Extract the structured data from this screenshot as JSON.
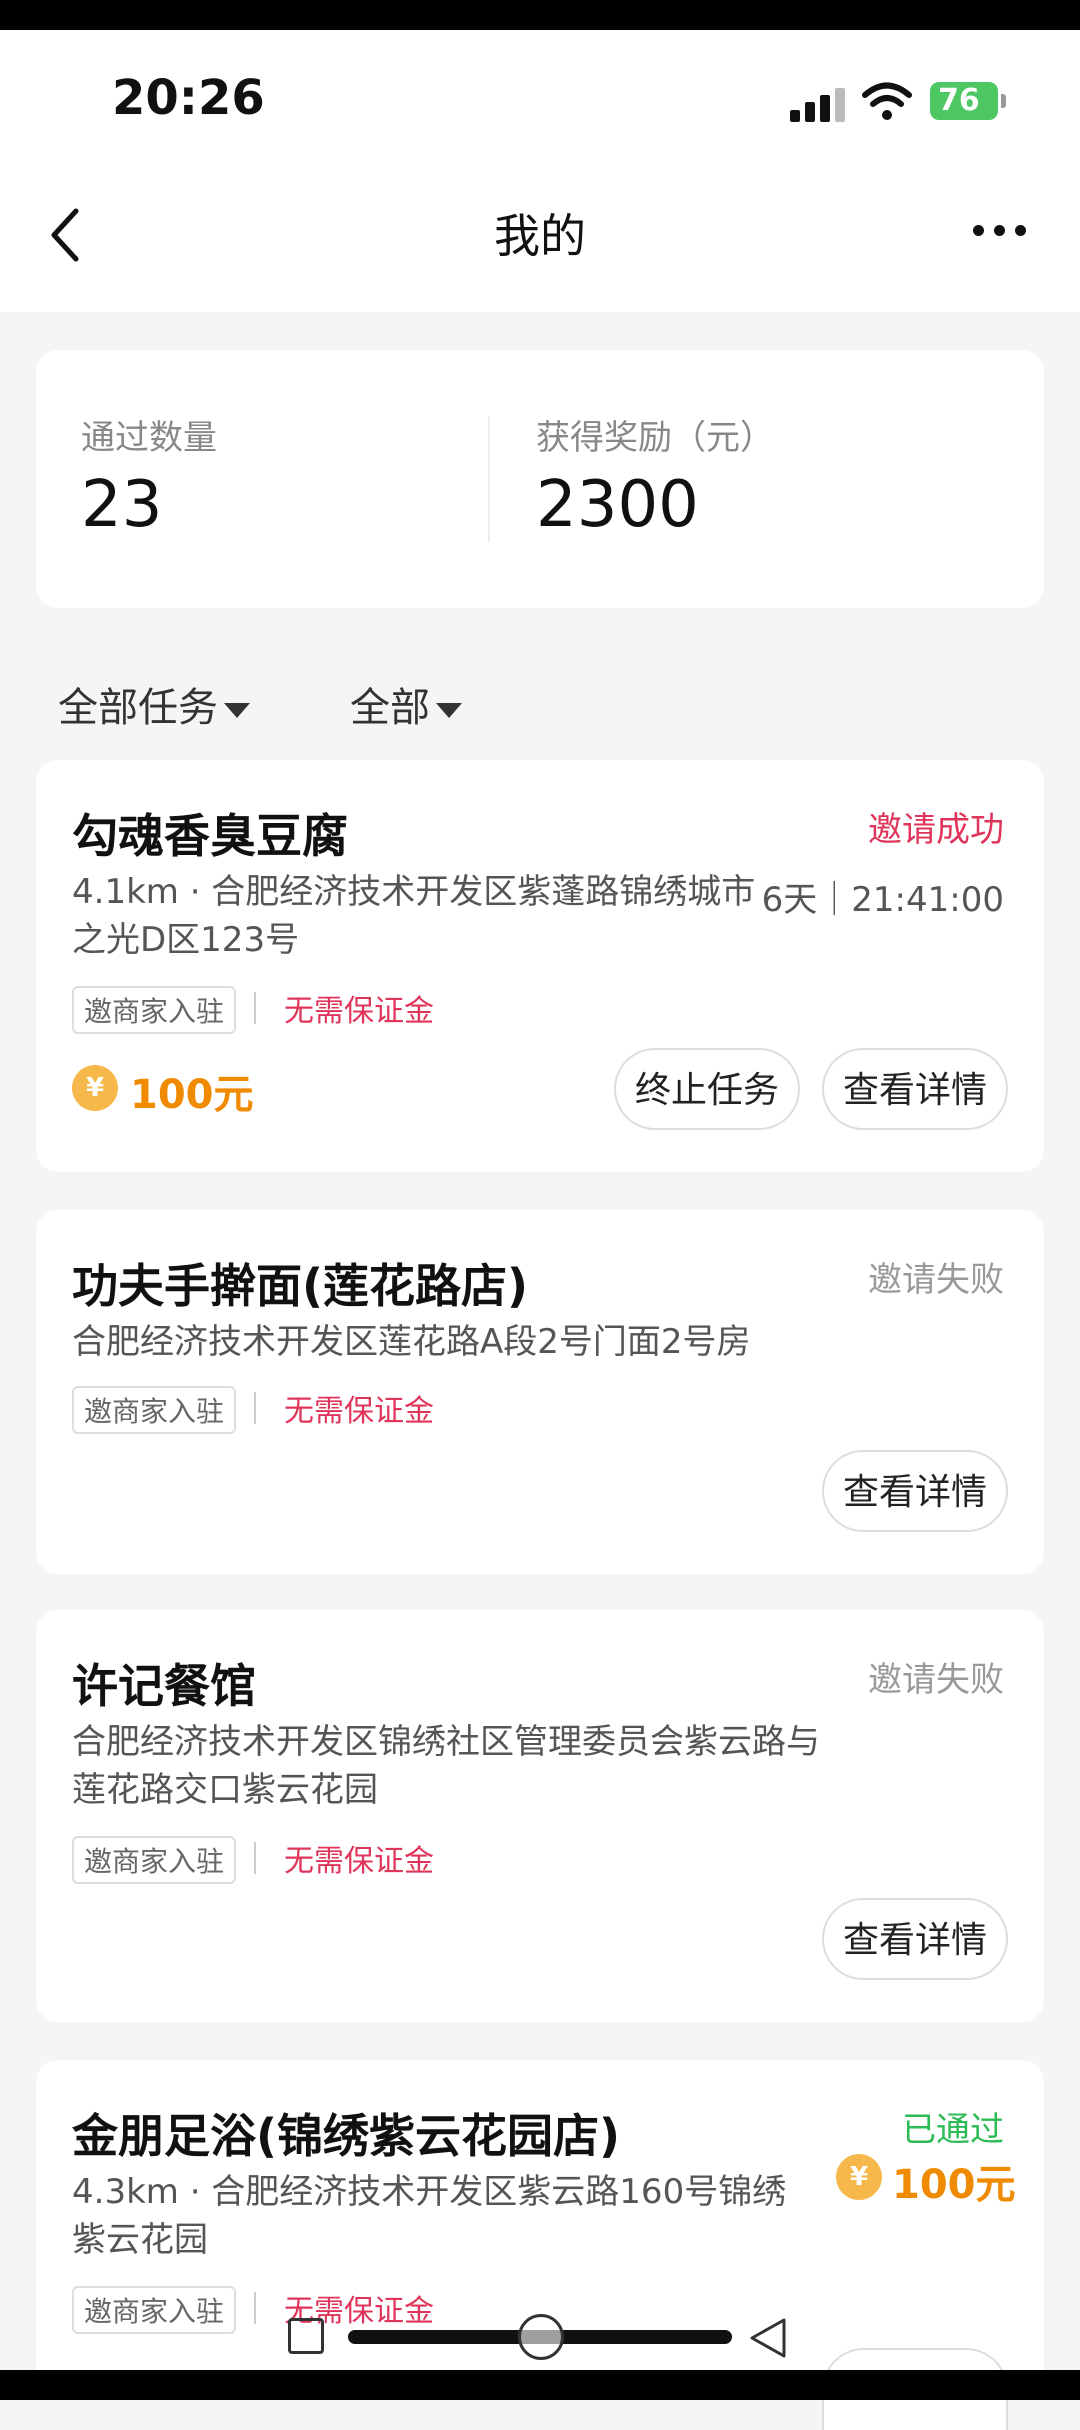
{
  "status_bar": {
    "time": "20:26",
    "battery": "76"
  },
  "header": {
    "title": "我的"
  },
  "stats": {
    "passed_label": "通过数量",
    "passed_value": "23",
    "reward_label": "获得奖励（元）",
    "reward_value": "2300"
  },
  "filters": {
    "task_filter": "全部任务",
    "status_filter": "全部"
  },
  "cards": [
    {
      "name": "勾魂香臭豆腐",
      "status": "邀请成功",
      "addr_line1": "4.1km · 合肥经济技术开发区紫蓬路锦绣城市",
      "addr_line2": "之光D区123号",
      "countdown": "6天｜21:41:00",
      "tag1": "邀商家入驻",
      "tag2": "无需保证金",
      "coin": "¥",
      "reward": "100元",
      "btn_stop": "终止任务",
      "btn_detail": "查看详情"
    },
    {
      "name": "功夫手擀面(莲花路店)",
      "status": "邀请失败",
      "addr_line1": "合肥经济技术开发区莲花路A段2号门面2号房",
      "tag1": "邀商家入驻",
      "tag2": "无需保证金",
      "btn_detail": "查看详情"
    },
    {
      "name": "许记餐馆",
      "status": "邀请失败",
      "addr_line1": "合肥经济技术开发区锦绣社区管理委员会紫云路与",
      "addr_line2": "莲花路交口紫云花园",
      "tag1": "邀商家入驻",
      "tag2": "无需保证金",
      "btn_detail": "查看详情"
    },
    {
      "name": "金朋足浴(锦绣紫云花园店)",
      "status": "已通过",
      "addr_line1": "4.3km · 合肥经济技术开发区紫云路160号锦绣",
      "addr_line2": "紫云花园",
      "coin": "¥",
      "reward": "100元",
      "tag1": "邀商家入驻",
      "tag2": "无需保证金"
    }
  ],
  "colors": {
    "success": "#e0355a",
    "failed": "#999999",
    "passed": "#2dbb55",
    "reward": "#f08a00"
  }
}
